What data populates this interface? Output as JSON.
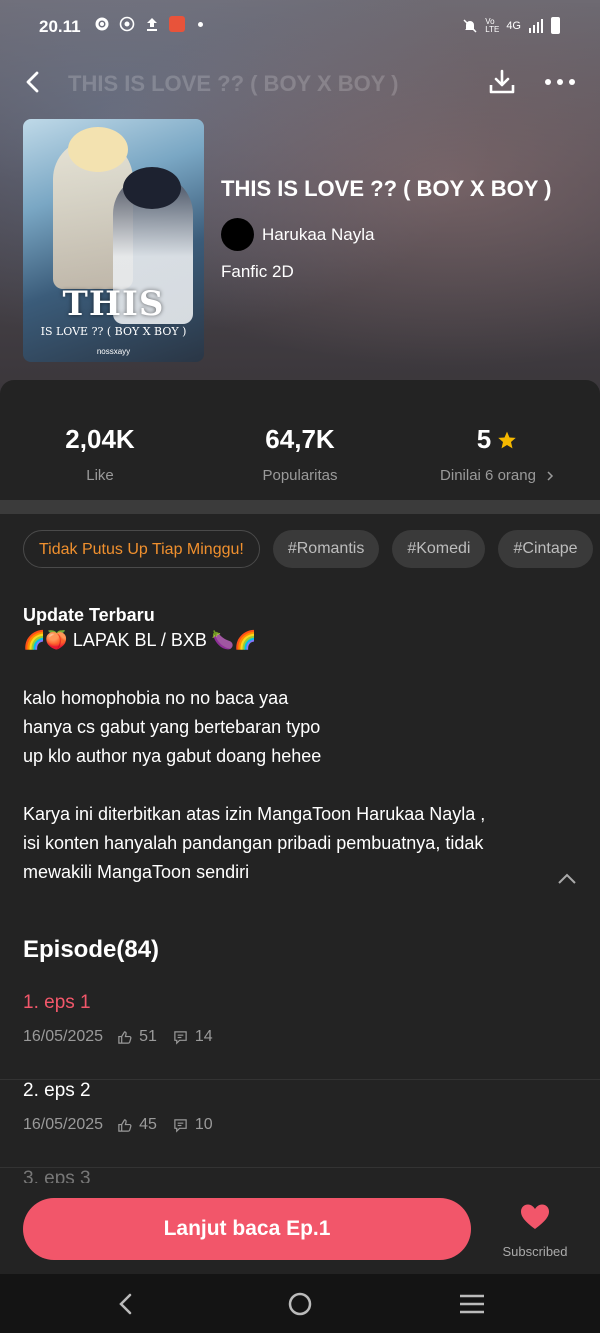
{
  "status_bar": {
    "time": "20.11",
    "network": "4G"
  },
  "header": {
    "title": "THIS IS LOVE ?? ( BOY X BOY )"
  },
  "book": {
    "cover_title": "THIS",
    "cover_subtitle": "IS LOVE ?? ( BOY X BOY )",
    "cover_author": "nossxayy",
    "title": "THIS IS LOVE ?? ( BOY X BOY )",
    "author": "Harukaa Nayla",
    "genre": "Fanfic 2D"
  },
  "stats": {
    "likes_value": "2,04K",
    "likes_label": "Like",
    "popularity_value": "64,7K",
    "popularity_label": "Popularitas",
    "rating_value": "5",
    "rating_label": "Dinilai 6 orang"
  },
  "tags": [
    "Tidak Putus Up Tiap Minggu!",
    "#Romantis",
    "#Komedi",
    "#Cintape"
  ],
  "description": {
    "heading": "Update Terbaru",
    "line1": "🌈🍑 LAPAK BL / BXB 🍆🌈",
    "line2": "kalo homophobia no no baca yaa",
    "line3": "hanya cs gabut yang bertebaran typo",
    "line4": "up klo author nya gabut doang hehee",
    "line5": "Karya ini diterbitkan atas izin MangaToon Harukaa Nayla ,",
    "line6": "isi konten hanyalah pandangan pribadi pembuatnya, tidak",
    "line7": "mewakili MangaToon sendiri"
  },
  "episodes_header": "Episode(84)",
  "episodes": [
    {
      "name": "1. eps 1",
      "date": "16/05/2025",
      "likes": "51",
      "comments": "14"
    },
    {
      "name": "2. eps 2",
      "date": "16/05/2025",
      "likes": "45",
      "comments": "10"
    },
    {
      "name": "3. eps 3"
    }
  ],
  "actions": {
    "read_button": "Lanjut baca Ep.1",
    "subscribe_label": "Subscribed"
  },
  "colors": {
    "accent": "#f2566a",
    "promo_tag": "#f0902e",
    "star": "#f5b800"
  }
}
